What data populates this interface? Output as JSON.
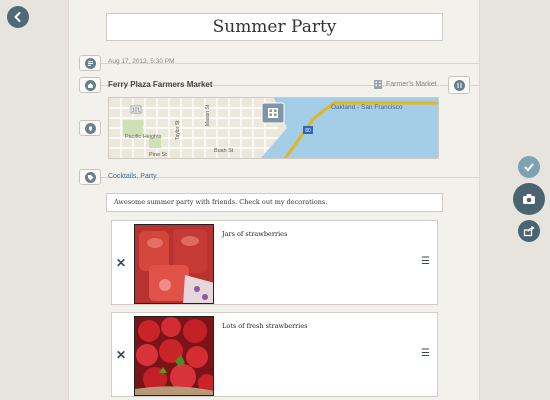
{
  "event": {
    "title": "Summer Party",
    "date": "Aug 17, 2012, 5:30 PM",
    "venue": "Ferry Plaza Farmers Market",
    "venue_type": "Farmer's Market",
    "tags": "Cocktails, Party",
    "description": "Awesome summer party with friends. Check out my decorations."
  },
  "map": {
    "street_labels": [
      "Mason St",
      "Taylor St",
      "Pacific Heights",
      "Pine St",
      "Bush St",
      "Oakland - San Francisco"
    ],
    "highway_shields": [
      "101",
      "80"
    ]
  },
  "photos": [
    {
      "caption": "Jars of strawberries"
    },
    {
      "caption": "Lots of fresh strawberries"
    }
  ],
  "icons": {
    "back": "back-arrow-icon",
    "note": "note-icon",
    "venue": "house-icon",
    "fork": "fork-knife-icon",
    "location": "location-pin-icon",
    "tag": "tag-icon",
    "delete": "close-icon",
    "drag": "drag-handle-icon",
    "check": "checkmark-icon",
    "camera": "camera-icon",
    "share": "share-icon"
  },
  "colors": {
    "accent": "#4e6977",
    "link": "#3d6f93",
    "map_water": "#a4cde8",
    "route": "#e3b51e"
  }
}
